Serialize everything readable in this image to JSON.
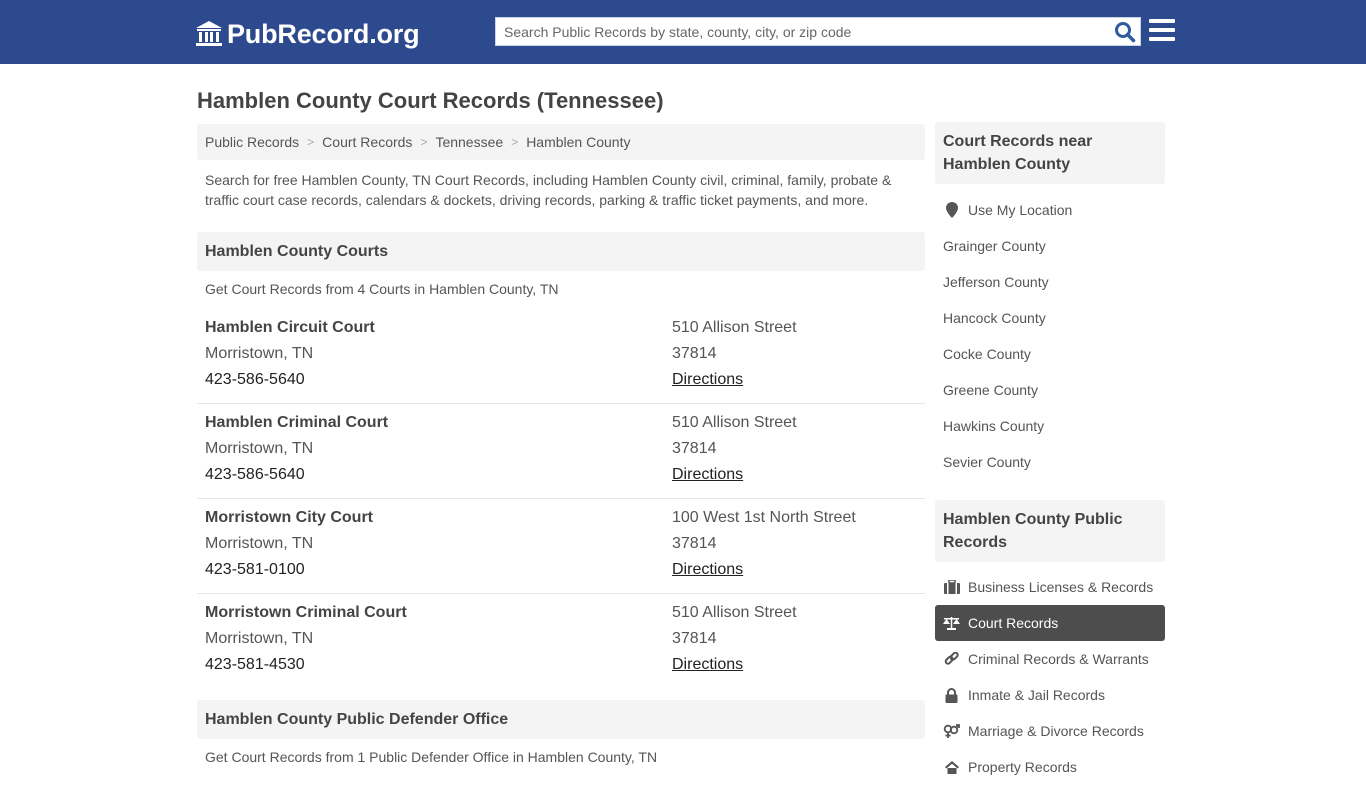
{
  "header": {
    "logo_text": "PubRecord.org",
    "search_placeholder": "Search Public Records by state, county, city, or zip code",
    "search_value": "",
    "brand_color": "#2e4a8e"
  },
  "page": {
    "title": "Hamblen County Court Records (Tennessee)",
    "breadcrumb": [
      "Public Records",
      "Court Records",
      "Tennessee",
      "Hamblen County"
    ],
    "breadcrumb_separator": ">",
    "intro": "Search for free Hamblen County, TN Court Records, including Hamblen County civil, criminal, family, probate & traffic court case records, calendars & dockets, driving records, parking & traffic ticket payments, and more."
  },
  "courts_section": {
    "heading": "Hamblen County Courts",
    "subtext": "Get Court Records from 4 Courts in Hamblen County, TN",
    "items": [
      {
        "name": "Hamblen Circuit Court",
        "city": "Morristown, TN",
        "phone": "423-586-5640",
        "address": "510 Allison Street",
        "zip": "37814",
        "directions": "Directions"
      },
      {
        "name": "Hamblen Criminal Court",
        "city": "Morristown, TN",
        "phone": "423-586-5640",
        "address": "510 Allison Street",
        "zip": "37814",
        "directions": "Directions"
      },
      {
        "name": "Morristown City Court",
        "city": "Morristown, TN",
        "phone": "423-581-0100",
        "address": "100 West 1st North Street",
        "zip": "37814",
        "directions": "Directions"
      },
      {
        "name": "Morristown Criminal Court",
        "city": "Morristown, TN",
        "phone": "423-581-4530",
        "address": "510 Allison Street",
        "zip": "37814",
        "directions": "Directions"
      }
    ]
  },
  "defender_section": {
    "heading": "Hamblen County Public Defender Office",
    "subtext": "Get Court Records from 1 Public Defender Office in Hamblen County, TN"
  },
  "sidebar": {
    "nearby": {
      "heading": "Court Records near Hamblen County",
      "use_location": {
        "label": "Use My Location",
        "icon": "map-marker-icon"
      },
      "counties": [
        "Grainger County",
        "Jefferson County",
        "Hancock County",
        "Cocke County",
        "Greene County",
        "Hawkins County",
        "Sevier County"
      ]
    },
    "public_records": {
      "heading": "Hamblen County Public Records",
      "items": [
        {
          "label": "Business Licenses & Records",
          "icon": "briefcase-icon",
          "active": false
        },
        {
          "label": "Court Records",
          "icon": "balance-scale-icon",
          "active": true
        },
        {
          "label": "Criminal Records & Warrants",
          "icon": "link-icon",
          "active": false
        },
        {
          "label": "Inmate & Jail Records",
          "icon": "lock-icon",
          "active": false
        },
        {
          "label": "Marriage & Divorce Records",
          "icon": "venus-mars-icon",
          "active": false
        },
        {
          "label": "Property Records",
          "icon": "home-icon",
          "active": false
        }
      ]
    }
  }
}
